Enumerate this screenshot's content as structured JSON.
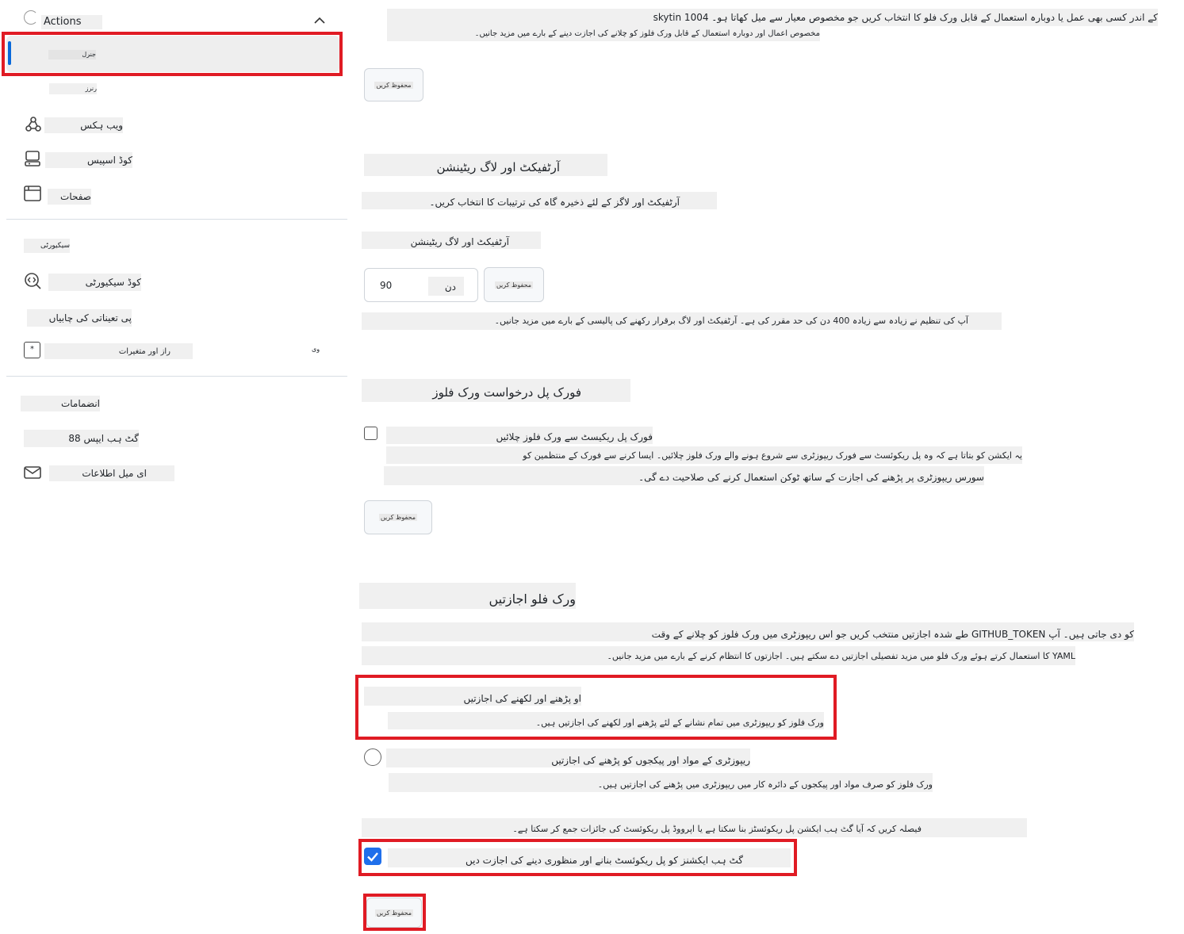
{
  "sidebar": {
    "actions_label": "Actions",
    "items": [
      {
        "label": "جنرل"
      },
      {
        "label": "رنرز"
      },
      {
        "label": "ویب ہکس"
      },
      {
        "label": "کوڈ اسپیس"
      },
      {
        "label": "صفحات"
      },
      {
        "label": "سیکیورٹی"
      },
      {
        "label": "کوڈ سیکیورٹی"
      },
      {
        "label": "پی تعیناتی کی چابیاں"
      },
      {
        "label": "راز اور متغیرات",
        "suffix": "وی"
      },
      {
        "label": "انضمامات"
      },
      {
        "label": "گٹ ہب ایپس 88"
      },
      {
        "label": "ای میل اطلاعات"
      }
    ]
  },
  "main": {
    "intro": {
      "line1": "کے اندر کسی بھی عمل یا دوبارہ استعمال کے قابل ورک فلو کا انتخاب کریں جو مخصوص معیار سے میل کھاتا ہو۔ skytin 1004",
      "line2": "مخصوص اعمال اور دوبارہ استعمال کے قابل ورک فلوز کو چلانے کی اجازت دینے کے بارے میں مزید جانیں۔",
      "save": "محفوظ کریں"
    },
    "artifact": {
      "heading": "آرٹفیکٹ اور لاگ ریٹینشن",
      "desc": "آرٹفیکٹ اور لاگز کے لئے ذخیرہ گاہ کی ترتیبات کا انتخاب کریں۔",
      "field_label": "آرٹفیکٹ اور لاگ ریٹینشن",
      "value": "90",
      "unit": "دن",
      "save": "محفوظ کریں",
      "note": "آپ کی تنظیم نے زیادہ سے زیادہ 400 دن کی حد مقرر کی ہے۔ آرٹفیکٹ اور لاگ برقرار رکھنے کی پالیسی کے بارے میں مزید جانیں۔"
    },
    "fork": {
      "heading": "فورک پل درخواست ورک فلوز",
      "checkbox_label": "فورک پل ریکیسٹ سے ورک فلوز چلائیں",
      "desc1": "یہ ایکشن کو بتاتا ہے کہ وہ پل ریکوئسٹ سے فورک ریپوزٹری سے شروع ہونے والے ورک فلوز چلائیں۔ ایسا کرنے سے فورک کے منتظمین کو",
      "desc2": "سورس ریپوزٹری پر پڑھنے کی اجازت کے ساتھ ٹوکن استعمال کرنے کی صلاحیت دے گی۔",
      "save": "محفوظ کریں"
    },
    "permissions": {
      "heading": "ورک فلو اجازتیں",
      "desc1": "طے شدہ اجازتیں منتخب کریں جو اس ریپوزٹری میں ورک فلوز کو چلانے کے وقت GITHUB_TOKEN کو دی جاتی ہیں۔ آپ",
      "desc2": "کا استعمال کرتے ہوئے ورک فلو میں مزید تفصیلی اجازتیں دے سکتے ہیں۔ اجازتوں کا انتظام کرنے کے بارے میں مزید جانیں۔ YAML",
      "opt1_title": "او پڑھنے اور لکھنے کی اجازتیں",
      "opt1_desc": "ورک فلوز کو ریپوزٹری میں تمام نشانے کے لئے پڑھنے اور لکھنے کی اجازتیں ہیں۔",
      "opt2_title": "ریپوزٹری کے مواد اور پیکجوں کو پڑھنے کی اجازتیں",
      "opt2_desc": "ورک فلوز کو صرف مواد اور پیکجوں کے دائرہ کار میں ریپوزٹری میں پڑھنے کی اجازتیں ہیں۔",
      "pr_note": "فیصلہ کریں کہ آیا گٹ ہب ایکشن پل ریکوئسٹز بنا سکتا ہے یا اپرووڈ پل ریکوئسٹ کی جائزات جمع کر سکتا ہے۔",
      "pr_checkbox": "گٹ ہب ایکشنز کو پل ریکوئسٹ بنانے اور منظوری دینے کی اجازت دیں",
      "save": "محفوظ کریں"
    }
  },
  "colors": {
    "highlight": "#e01b24",
    "accent": "#0969da",
    "checkbox": "#1f6feb"
  }
}
